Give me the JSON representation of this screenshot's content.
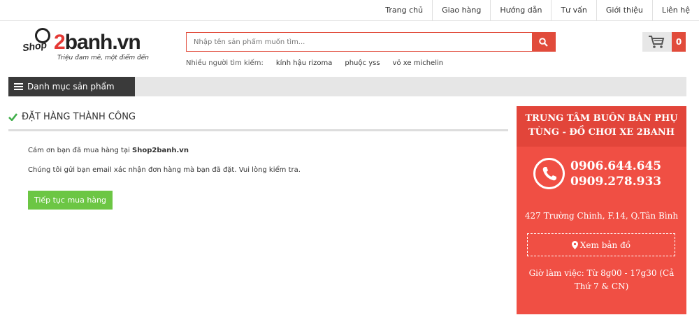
{
  "topnav": [
    "Trang chủ",
    "Giao hàng",
    "Hướng dẫn",
    "Tư vấn",
    "Giới thiệu",
    "Liên hệ"
  ],
  "logo": {
    "shop": "Shop",
    "brand_num": "2",
    "brand_text": "banh.vn",
    "tagline": "Triệu đam mê, một điểm đến"
  },
  "search": {
    "placeholder": "Nhập tên sản phẩm muốn tìm...",
    "icon": "search-icon"
  },
  "hints": {
    "label": "Nhiều người tìm kiếm:",
    "items": [
      "kính hậu rizoma",
      "phuộc yss",
      "vỏ xe michelin"
    ]
  },
  "cart": {
    "count": "0",
    "icon": "cart-icon"
  },
  "category": {
    "label": "Danh mục sản phẩm",
    "icon": "menu-icon"
  },
  "order": {
    "title": "ĐẶT HÀNG THÀNH CÔNG",
    "thanks_prefix": "Cám ơn bạn đã mua hàng tại ",
    "thanks_shop": "Shop2banh.vn",
    "email_msg": "Chúng tôi gửi bạn email xác nhận đơn hàng mà bạn đã đặt. Vui lòng kiểm tra.",
    "continue_label": "Tiếp tục mua hàng"
  },
  "sidebar": {
    "title": "TRUNG TÂM BUÔN BÁN PHỤ TÙNG - ĐỒ CHƠI XE 2BANH",
    "phone1": "0906.644.645",
    "phone2": "0909.278.933",
    "address": "427 Trường Chinh, F.14, Q.Tân Bình",
    "map_label": "Xem bản đồ",
    "hours": "Giờ làm việc: Từ 8g00 - 17g30 (Cả Thứ 7 & CN)"
  },
  "colors": {
    "accent": "#e14b3b",
    "panel": "#f04f44",
    "button": "#6cc644",
    "check": "#4caf50"
  }
}
